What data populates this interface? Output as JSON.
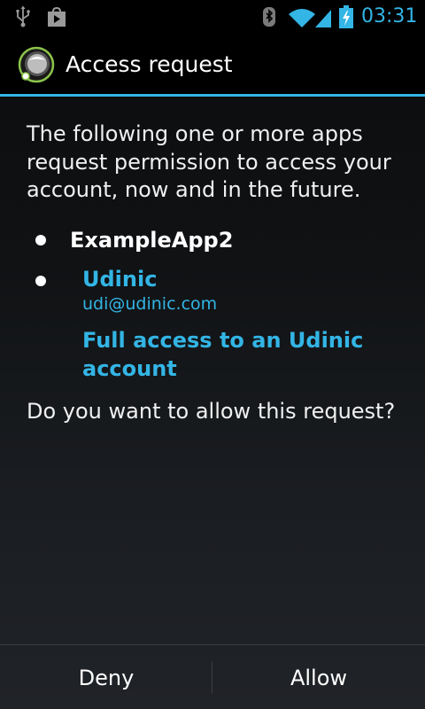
{
  "status_bar": {
    "time": "03:31",
    "icons": [
      "usb-icon",
      "play-store-icon",
      "bluetooth-icon",
      "wifi-icon",
      "signal-icon",
      "battery-charging-icon"
    ],
    "accent_color": "#33b5e5"
  },
  "title_bar": {
    "title": "Access request",
    "icon": "app-icon"
  },
  "content": {
    "intro": "The following one or more apps request permission to access your account, now and in the future.",
    "app_name": "ExampleApp2",
    "account_name": "Udinic",
    "account_email": "udi@udinic.com",
    "permission": "Full access to an Udinic account",
    "question": "Do you want to allow this request?"
  },
  "buttons": {
    "deny": "Deny",
    "allow": "Allow"
  }
}
